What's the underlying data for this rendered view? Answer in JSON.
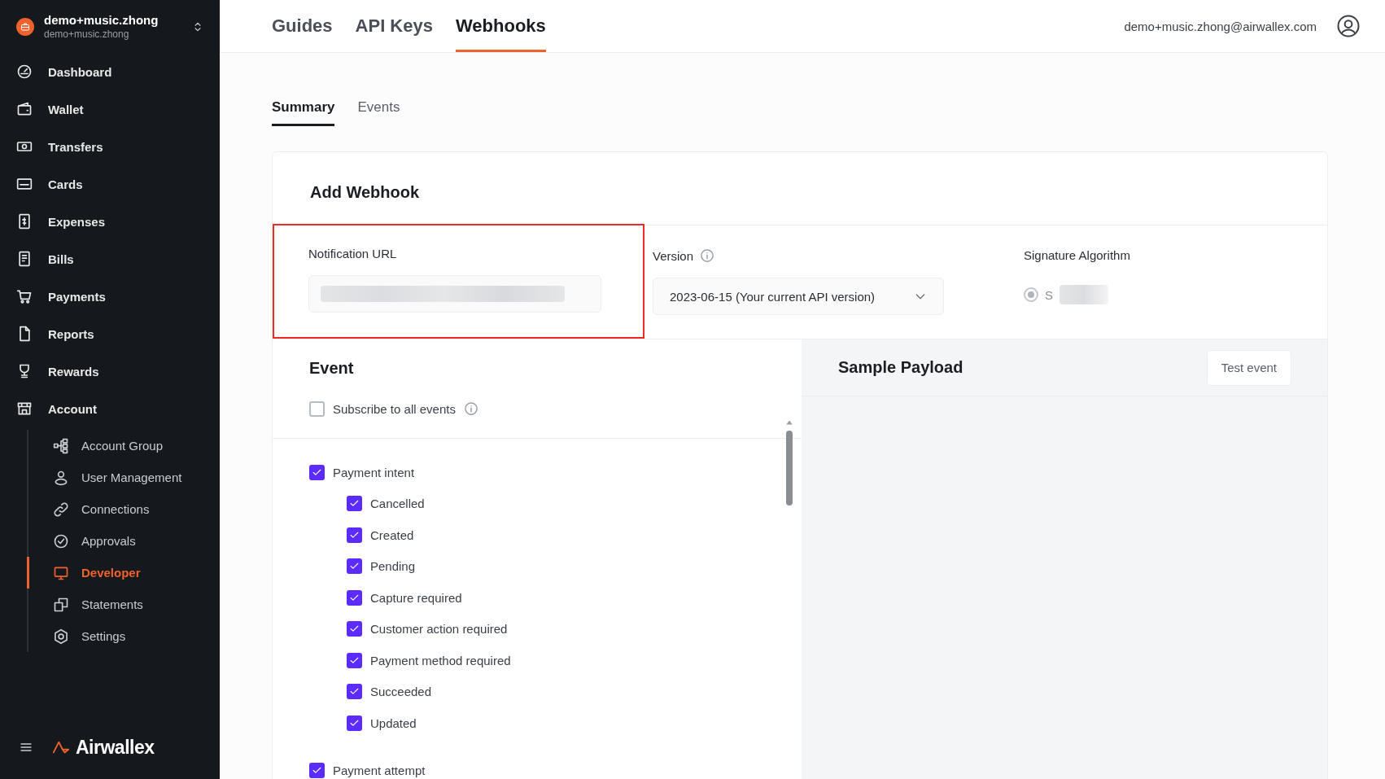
{
  "account": {
    "name": "demo+music.zhong",
    "subtitle": "demo+music.zhong"
  },
  "sidebar": {
    "items": [
      {
        "label": "Dashboard",
        "selected": false
      },
      {
        "label": "Wallet",
        "selected": false
      },
      {
        "label": "Transfers",
        "selected": false
      },
      {
        "label": "Cards",
        "selected": false
      },
      {
        "label": "Expenses",
        "selected": false
      },
      {
        "label": "Bills",
        "selected": false
      },
      {
        "label": "Payments",
        "selected": false
      },
      {
        "label": "Reports",
        "selected": false
      },
      {
        "label": "Rewards",
        "selected": false
      },
      {
        "label": "Account",
        "selected": false,
        "children": [
          {
            "label": "Account Group",
            "selected": false
          },
          {
            "label": "User Management",
            "selected": false
          },
          {
            "label": "Connections",
            "selected": false
          },
          {
            "label": "Approvals",
            "selected": false
          },
          {
            "label": "Developer",
            "selected": true
          },
          {
            "label": "Statements",
            "selected": false
          },
          {
            "label": "Settings",
            "selected": false
          }
        ]
      }
    ]
  },
  "brand": {
    "name": "Airwallex"
  },
  "top_tabs": [
    {
      "label": "Guides",
      "selected": false
    },
    {
      "label": "API Keys",
      "selected": false
    },
    {
      "label": "Webhooks",
      "selected": true
    }
  ],
  "user_email": "demo+music.zhong@airwallex.com",
  "sub_tabs": [
    {
      "label": "Summary",
      "selected": true
    },
    {
      "label": "Events",
      "selected": false
    }
  ],
  "form": {
    "title": "Add Webhook",
    "notification_url": {
      "label": "Notification URL",
      "highlighted": true
    },
    "version": {
      "label": "Version",
      "value": "2023-06-15 (Your current API version)"
    },
    "signature_algorithm": {
      "label": "Signature Algorithm",
      "option": "S",
      "selected": true
    }
  },
  "event": {
    "title": "Event",
    "subscribe_all": {
      "label": "Subscribe to all events",
      "checked": false
    },
    "groups": [
      {
        "label": "Payment intent",
        "checked": true,
        "children": [
          {
            "label": "Cancelled",
            "checked": true
          },
          {
            "label": "Created",
            "checked": true
          },
          {
            "label": "Pending",
            "checked": true
          },
          {
            "label": "Capture required",
            "checked": true
          },
          {
            "label": "Customer action required",
            "checked": true
          },
          {
            "label": "Payment method required",
            "checked": true
          },
          {
            "label": "Succeeded",
            "checked": true
          },
          {
            "label": "Updated",
            "checked": true
          }
        ]
      },
      {
        "label": "Payment attempt",
        "checked": true
      }
    ]
  },
  "sample_payload": {
    "title": "Sample Payload",
    "button": "Test event"
  }
}
